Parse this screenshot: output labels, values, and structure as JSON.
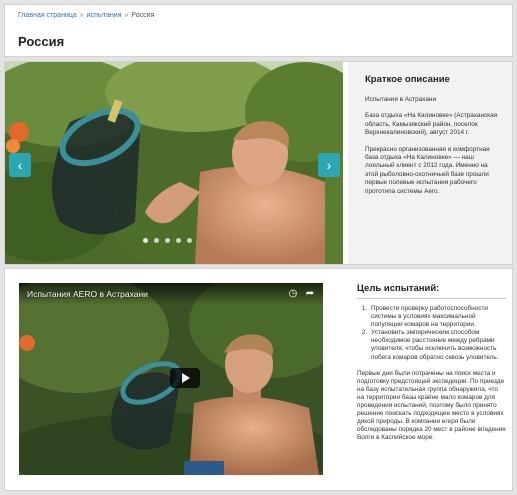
{
  "breadcrumb": {
    "home": "Главная страница",
    "section": "испытания",
    "current": "Россия",
    "separator": "»"
  },
  "page": {
    "title": "Россия"
  },
  "slider": {
    "prev_icon": "chevron-left-icon",
    "next_icon": "chevron-right-icon",
    "prev_label": "‹",
    "next_label": "›",
    "dot_count": 5,
    "active_dot": 0
  },
  "description": {
    "heading": "Краткое описание",
    "subtitle": "Испытания в Астрахани",
    "para1": "База отдыха «На Калиновке» (Астраханская область, Камызякский район, поселок Верхнекалиновский), август 2014 г.",
    "para2": "Прекрасно организованная и комфортная база отдыха «На Калиновке» — наш лояльный клиент с 2012 года. Именно на этой рыболовно-охотничьей базе прошли первые полевые испытания рабочего прототипа системы Aero."
  },
  "video": {
    "title": "Испытания AERO в Астрахани",
    "watch_later_icon": "clock-icon",
    "share_icon": "share-icon",
    "play_icon": "play-icon"
  },
  "goals": {
    "heading": "Цель испытаний:",
    "items": [
      "Провести проверку работоспособности системы в условиях максимальной популяции комаров на территории.",
      "Установить эмпирическим способом необходимое расстояние между ребрами уловителя, чтобы исключить возможность побега комаров обратно сквозь уловитель."
    ],
    "paragraph": "Первые дни были потрачены на поиск места и подготовку предстоящей экспедиции. По приезде на базу испытательная группа обнаружила, что на территории базы крайне мало комаров для проведения испытаний, поэтому было принято решение поискать подходящее место в условиях дикой природы. В компании егеря были обследованы порядка 20 мест в районе впадения Волги в Каспийское море."
  },
  "colors": {
    "accent": "#2ca6b3",
    "link": "#3478a7",
    "desc_bg": "#f2f2f2"
  }
}
